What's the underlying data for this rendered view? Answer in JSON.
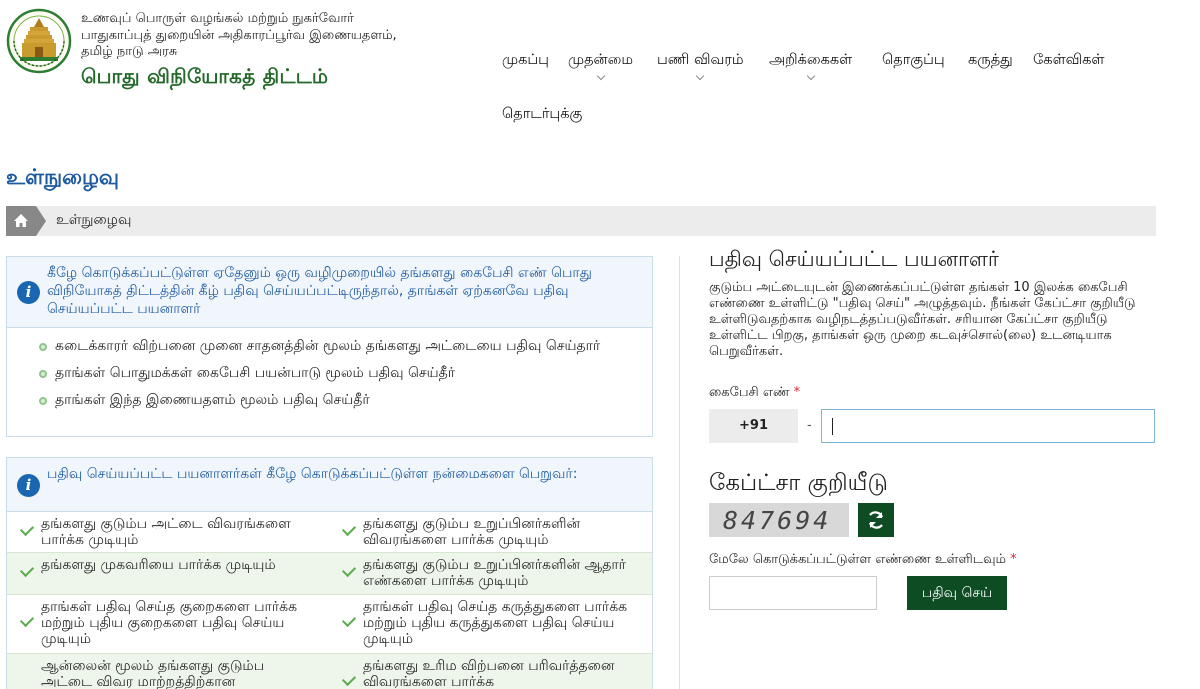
{
  "header": {
    "dept_lines": [
      "உணவுப் பொருள் வழங்கல் மற்றும் நுகர்வோர்",
      "பாதுகாப்புத் துறையின் அதிகாரப்பூர்வ இணையதளம்,",
      "தமிழ் நாடு அரசு"
    ],
    "site_title": "பொது விநியோகத் திட்டம்"
  },
  "nav": {
    "items": [
      {
        "label": "முகப்பு",
        "has_dropdown": false
      },
      {
        "label": "முதன்மை",
        "has_dropdown": true
      },
      {
        "label": "பணி விவரம்",
        "has_dropdown": true
      },
      {
        "label": "அறிக்கைகள்",
        "has_dropdown": true
      },
      {
        "label": "தொகுப்பு",
        "has_dropdown": false
      },
      {
        "label": "கருத்து",
        "has_dropdown": false
      },
      {
        "label": "கேள்விகள்",
        "has_dropdown": false
      },
      {
        "label": "தொடர்புக்கு",
        "has_dropdown": false
      }
    ]
  },
  "page": {
    "title": "உள்நுழைவு",
    "breadcrumb": "உள்நுழைவு"
  },
  "info_box": {
    "heading": "கீழே கொடுக்கப்பட்டுள்ள ஏதேனும் ஒரு வழிமுறையில் தங்களது கைபேசி எண் பொது விநியோகத் திட்டத்தின் கீழ் பதிவு செய்யப்பட்டிருந்தால், தாங்கள் ஏற்கனவே பதிவு செய்யப்பட்ட பயனாளர்",
    "items": [
      "கடைக்காரர் விற்பனை முனை சாதனத்தின் மூலம் தங்களது அட்டையை பதிவு செய்தார்",
      "தாங்கள் பொதுமக்கள் கைபேசி பயன்பாடு மூலம் பதிவு செய்தீர்",
      "தாங்கள் இந்த இணையதளம் மூலம் பதிவு செய்தீர்"
    ]
  },
  "benefits_box": {
    "heading": "பதிவு செய்யப்பட்ட பயனாளர்கள் கீழே கொடுக்கப்பட்டுள்ள நன்மைகளை பெறுவர்:",
    "rows": [
      [
        "தங்களது குடும்ப அட்டை விவரங்களை பார்க்க முடியும்",
        "தங்களது குடும்ப உறுப்பினர்களின் விவரங்களை பார்க்க முடியும்"
      ],
      [
        "தங்களது முகவரியை பார்க்க முடியும்",
        "தங்களது குடும்ப உறுப்பினர்களின் ஆதார் எண்களை பார்க்க முடியும்"
      ],
      [
        "தாங்கள் பதிவு செய்த குறைகளை பார்க்க மற்றும் புதிய குறைகளை பதிவு செய்ய முடியும்",
        "தாங்கள் பதிவு செய்த கருத்துகளை பார்க்க மற்றும் புதிய கருத்துகளை பதிவு செய்ய முடியும்"
      ],
      [
        "ஆன்லைன் மூலம் தங்களது குடும்ப அட்டை விவர மாற்றத்திற்கான",
        "தங்களது உரிம விற்பனை பரிவர்த்தனை விவரங்களை பார்க்க"
      ]
    ]
  },
  "login": {
    "title": "பதிவு செய்யப்பட்ட பயனாளர்",
    "description": "குடும்ப அட்டையுடன் இணைக்கப்பட்டுள்ள தங்கள் 10 இலக்க கைபேசி எண்ணை உள்ளிட்டு \"பதிவு செய்\" அழுத்தவும். நீங்கள் கேப்ட்சா குறியீடு உள்ளிடுவதற்காக வழிநடத்தப்படுவீர்கள். சரியான கேப்ட்சா குறியீடு உள்ளிட்ட பிறகு, தாங்கள் ஒரு முறை கடவுச்சொல்(லை) உடனடியாக பெறுவீர்கள்.",
    "mobile_label": "கைபேசி எண்",
    "required_mark": "*",
    "country_code": "+91",
    "separator": "-",
    "mobile_value": "",
    "captcha_title": "கேப்ட்சா குறியீடு",
    "captcha_code": "847694",
    "captcha_input_label": "மேலே கொடுக்கப்பட்டுள்ள எண்ணை உள்ளிடவும்",
    "captcha_value": "",
    "submit_label": "பதிவு செய்"
  },
  "colors": {
    "brand_green": "#0e4d24",
    "title_green": "#23692a",
    "link_blue": "#1e5aa0",
    "info_icon_blue": "#1b66b1",
    "check_green": "#5cab4c",
    "required_red": "#d9272e"
  }
}
